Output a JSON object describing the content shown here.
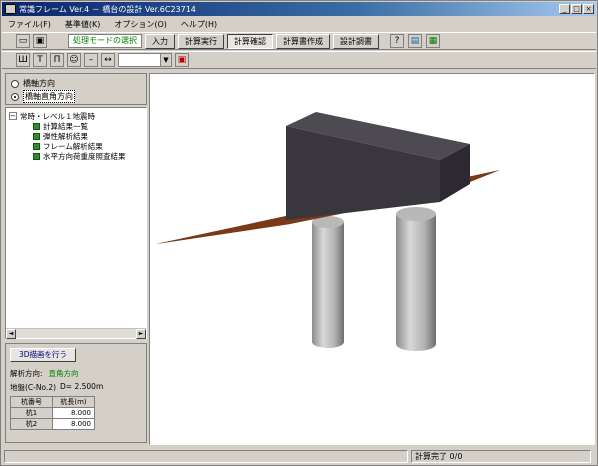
{
  "window": {
    "title": "常識フレーム Ver.4 － 橋台の設計 Ver.6C23714",
    "buttons": [
      "_",
      "□",
      "×"
    ]
  },
  "menu": [
    "ファイル(F)",
    "基準値(K)",
    "オプション(O)",
    "ヘルプ(H)"
  ],
  "toolbar1": {
    "mode_label": "処理モードの選択",
    "tabs": [
      "入力",
      "計算実行",
      "計算確認",
      "計算書作成",
      "設計調書"
    ],
    "active_tab": "計算確認"
  },
  "toolbar2": {
    "zoom_value": ""
  },
  "left_panel": {
    "radio_options": [
      "橋軸方向",
      "橋軸直角方向"
    ],
    "selected_radio": "橋軸直角方向",
    "tree_root": "常時・レベル１地震時",
    "tree_children": [
      "計算結果一覧",
      "弾性解析結果",
      "フレーム解析結果",
      "水平方向荷重度照査結果"
    ],
    "button_3d": "3D描画を行う",
    "direction_label": "解析方向:",
    "direction_value": "直角方向",
    "ground_label": "地盤(C-No.2)",
    "ground_value": "D= 2.500m",
    "pile_table": {
      "headers": [
        "杭番号",
        "杭長(m)"
      ],
      "rows": [
        [
          "杭1",
          "8.000"
        ],
        [
          "杭2",
          "8.000"
        ]
      ]
    }
  },
  "status": {
    "left": "",
    "right": "計算完了  0/0"
  }
}
